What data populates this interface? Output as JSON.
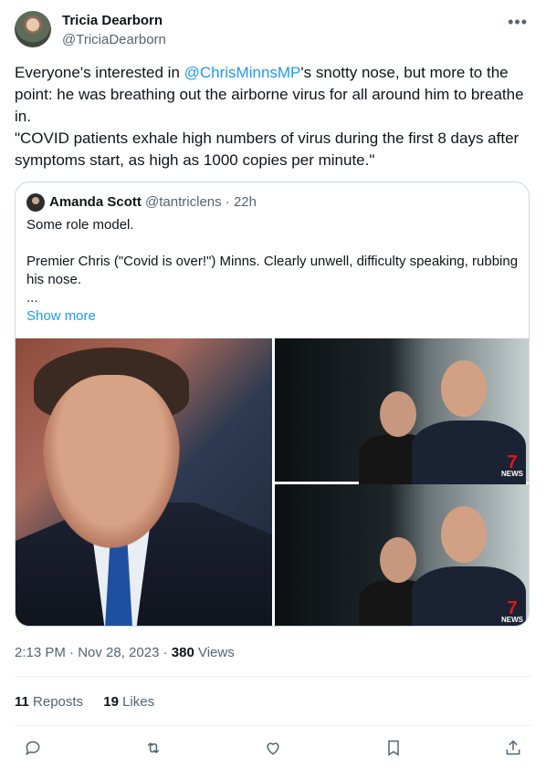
{
  "author": {
    "name": "Tricia Dearborn",
    "handle": "@TriciaDearborn"
  },
  "tweet": {
    "text_before_mention": "Everyone's interested in ",
    "mention": "@ChrisMinnsMP",
    "text_after_mention": "'s snotty nose, but more to the point: he was breathing out the airborne virus for all around him to breathe in.",
    "quote_line": "\"COVID patients exhale high numbers of virus during the first 8 days after symptoms start, as high as 1000 copies per minute.\""
  },
  "quoted": {
    "name": "Amanda Scott",
    "handle": "@tantriclens",
    "separator": "·",
    "age": "22h",
    "para1": "Some role model.",
    "para2": "Premier Chris (\"Covid is over!\") Minns.  Clearly unwell, difficulty speaking, rubbing his nose.",
    "ellipsis": "...",
    "show_more": "Show more",
    "badge_top": "NEWS",
    "badge_bottom": "NEWS",
    "badge_number": "7"
  },
  "meta": {
    "timestamp": "2:13 PM · Nov 28, 2023 · ",
    "views_count": "380",
    "views_label": " Views"
  },
  "stats": {
    "reposts_count": "11",
    "reposts_label": "Reposts",
    "likes_count": "19",
    "likes_label": "Likes"
  },
  "icons": {
    "more": "more-icon",
    "reply": "reply-icon",
    "repost": "repost-icon",
    "like": "like-icon",
    "bookmark": "bookmark-icon",
    "share": "share-icon"
  },
  "colors": {
    "accent": "#1d9bf0",
    "muted": "#536471",
    "border": "#cfd9de"
  }
}
